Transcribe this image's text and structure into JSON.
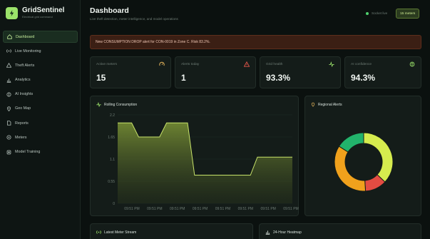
{
  "brand": {
    "name": "GridSentinel",
    "subtitle": "Electrical grid command"
  },
  "sidebar": {
    "items": [
      {
        "label": "Dashboard",
        "icon": "home-icon",
        "active": true
      },
      {
        "label": "Live Monitoring",
        "icon": "signal-icon"
      },
      {
        "label": "Theft Alerts",
        "icon": "warning-icon"
      },
      {
        "label": "Analytics",
        "icon": "bar-chart-icon"
      },
      {
        "label": "AI Insights",
        "icon": "brain-icon"
      },
      {
        "label": "Geo Map",
        "icon": "map-pin-icon"
      },
      {
        "label": "Reports",
        "icon": "document-icon"
      },
      {
        "label": "Meters",
        "icon": "meter-icon"
      },
      {
        "label": "Model Training",
        "icon": "chip-icon"
      }
    ]
  },
  "header": {
    "title": "Dashboard",
    "subtitle": "Live theft detection, meter intelligence, and model operations",
    "socket_status": "Socket live",
    "meters_badge": "15 meters"
  },
  "alert_banner": {
    "text": "New CONSUMPTION DROP alert for CON-0019 in Zone C. Risk 83.2%."
  },
  "kpis": [
    {
      "label": "Active meters",
      "value": "15",
      "icon": "gauge-icon",
      "icon_color": "#e0b15a"
    },
    {
      "label": "Alerts today",
      "value": "1",
      "icon": "warning-icon",
      "icon_color": "#e5574b"
    },
    {
      "label": "Grid health",
      "value": "93.3%",
      "icon": "pulse-icon",
      "icon_color": "#9be26a"
    },
    {
      "label": "AI confidence",
      "value": "94.3%",
      "icon": "brain-icon",
      "icon_color": "#9be26a"
    }
  ],
  "rolling_card": {
    "title": "Rolling Consumption"
  },
  "regional_card": {
    "title": "Regional Alerts"
  },
  "bottom_cards": [
    {
      "title": "Latest Meter Stream"
    },
    {
      "title": "24-Hour Heatmap"
    }
  ],
  "chart_data": [
    {
      "type": "area",
      "title": "Rolling Consumption",
      "x": [
        "09:51 PM",
        "09:51 PM",
        "09:51 PM",
        "09:51 PM",
        "09:51 PM",
        "09:51 PM",
        "09:51 PM",
        "09:51 PM",
        "09:51 PM",
        "09:51 PM",
        "09:51 PM",
        "09:51 PM",
        "09:51 PM",
        "09:51 PM",
        "09:51 PM",
        "09:51 PM",
        "09:51 PM",
        "09:51 PM",
        "09:51 PM",
        "09:51 PM",
        "09:51 PM",
        "09:51 PM",
        "09:51 PM",
        "09:51 PM",
        "09:51 PM",
        "09:51 PM"
      ],
      "x_tick_labels": [
        "09:51 PM",
        "09:51 PM",
        "09:51 PM",
        "09:51 PM",
        "09:51 PM",
        "09:51 PM",
        "09:51 PM",
        "09:51 PM"
      ],
      "values": [
        2.0,
        2.0,
        2.0,
        1.65,
        1.65,
        1.65,
        1.65,
        2.0,
        2.0,
        2.0,
        2.0,
        0.7,
        0.7,
        0.7,
        0.7,
        0.7,
        0.7,
        0.7,
        0.7,
        0.7,
        1.15,
        1.15,
        1.15,
        1.15,
        1.15,
        1.15
      ],
      "y_ticks": [
        0,
        0.55,
        1.1,
        1.65,
        2.2
      ],
      "ylim": [
        0,
        2.2
      ],
      "grid": true,
      "color": "#c7e26a"
    },
    {
      "type": "pie",
      "title": "Regional Alerts",
      "categories": [
        "",
        "",
        "",
        ""
      ],
      "values": [
        37,
        12,
        35,
        16
      ],
      "colors": [
        "#d6ec4e",
        "#e34c42",
        "#f0a11c",
        "#22b36b"
      ],
      "donut": true
    }
  ]
}
